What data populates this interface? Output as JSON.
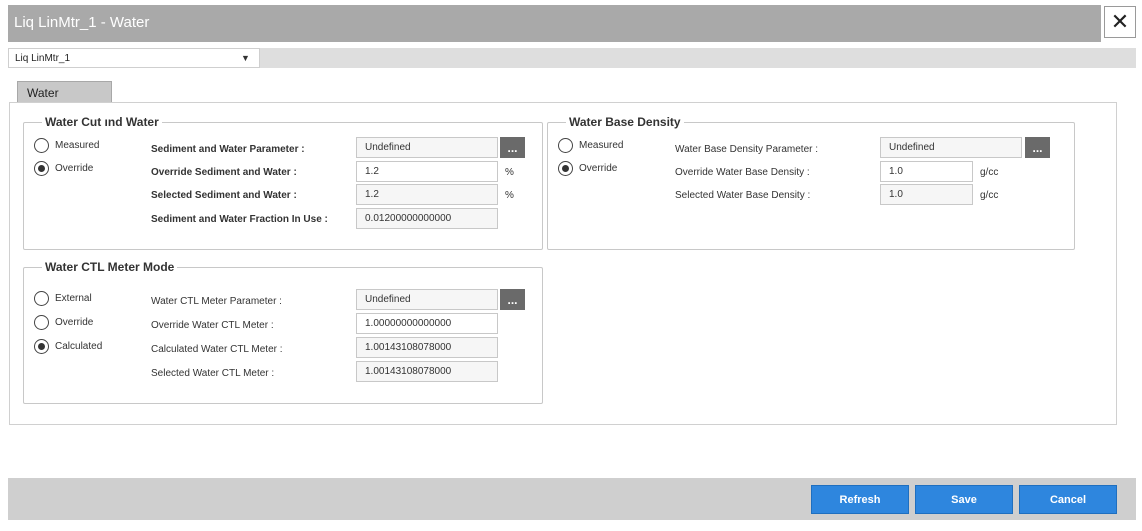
{
  "window": {
    "title": "Liq LinMtr_1 - Water",
    "close_symbol": "✕"
  },
  "meter_select": {
    "value": "Liq LinMtr_1",
    "arrow": "▼"
  },
  "tab": {
    "label": "Water"
  },
  "water_cut": {
    "legend": "Water Cut ınd Water",
    "radio_measured": "Measured",
    "radio_override": "Override",
    "selected_mode": "Override",
    "rows": [
      {
        "label": "Sediment and Water Parameter :",
        "value": "Undefined",
        "unit": ""
      },
      {
        "label": "Override Sediment and Water :",
        "value": "1.2",
        "unit": "%"
      },
      {
        "label": "Selected Sediment and Water :",
        "value": "1.2",
        "unit": "%"
      },
      {
        "label": "Sediment and Water Fraction In Use :",
        "value": "0.01200000000000",
        "unit": ""
      }
    ]
  },
  "base_density": {
    "legend": "Water Base Density",
    "radio_measured": "Measured",
    "radio_override": "Override",
    "selected_mode": "Override",
    "rows": [
      {
        "label": "Water Base Density Parameter :",
        "value": "Undefined",
        "unit": ""
      },
      {
        "label": "Override Water Base Density :",
        "value": "1.0",
        "unit": "g/cc"
      },
      {
        "label": "Selected Water Base Density :",
        "value": "1.0",
        "unit": "g/cc"
      }
    ]
  },
  "ctl": {
    "legend": "Water CTL Meter Mode",
    "radio_external": "External",
    "radio_override": "Override",
    "radio_calculated": "Calculated",
    "selected_mode": "Calculated",
    "rows": [
      {
        "label": "Water CTL Meter Parameter :",
        "value": "Undefined"
      },
      {
        "label": "Override Water CTL Meter :",
        "value": "1.00000000000000"
      },
      {
        "label": "Calculated Water CTL Meter :",
        "value": "1.00143108078000"
      },
      {
        "label": "Selected Water CTL Meter :",
        "value": "1.00143108078000"
      }
    ]
  },
  "ellipsis": "...",
  "buttons": {
    "refresh": "Refresh",
    "save": "Save",
    "cancel": "Cancel"
  },
  "colors": {
    "primary_button": "#2e86de",
    "title_bar": "#a9a9a9"
  }
}
